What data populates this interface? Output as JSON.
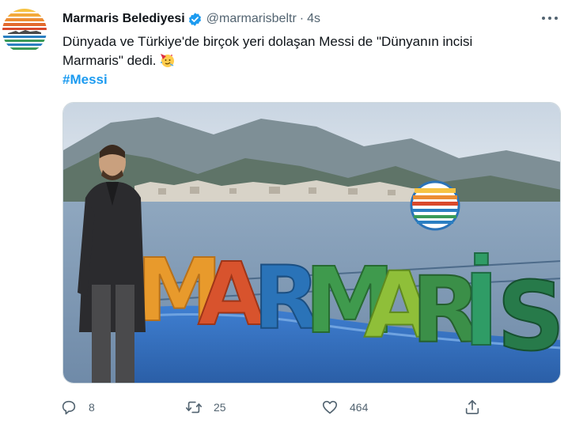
{
  "tweet": {
    "author": {
      "display_name": "Marmaris Belediyesi",
      "handle": "@marmarisbeltr",
      "verified": true
    },
    "separator": "·",
    "timestamp": "4s",
    "text_line1": "Dünyada ve Türkiye'de birçok yeri dolaşan Messi de  \"Dünyanın incisi",
    "text_line2": "Marmaris\" dedi.",
    "emoji": "party-face-emoji",
    "hashtag": "#Messi",
    "media": {
      "sign_letters": [
        "M",
        "A",
        "R",
        "M",
        "A",
        "R",
        "İ",
        "S"
      ],
      "sign_colors": [
        "#e89a2c",
        "#d8532d",
        "#2a73b8",
        "#3f9a4d",
        "#8fbf39",
        "#3b8f48",
        "#2f9c66",
        "#277a4a"
      ]
    },
    "actions": {
      "reply_count": "8",
      "retweet_count": "25",
      "like_count": "464",
      "share_label": ""
    }
  },
  "colors": {
    "accent": "#1d9bf0",
    "text_primary": "#0f1419",
    "text_secondary": "#536471"
  }
}
